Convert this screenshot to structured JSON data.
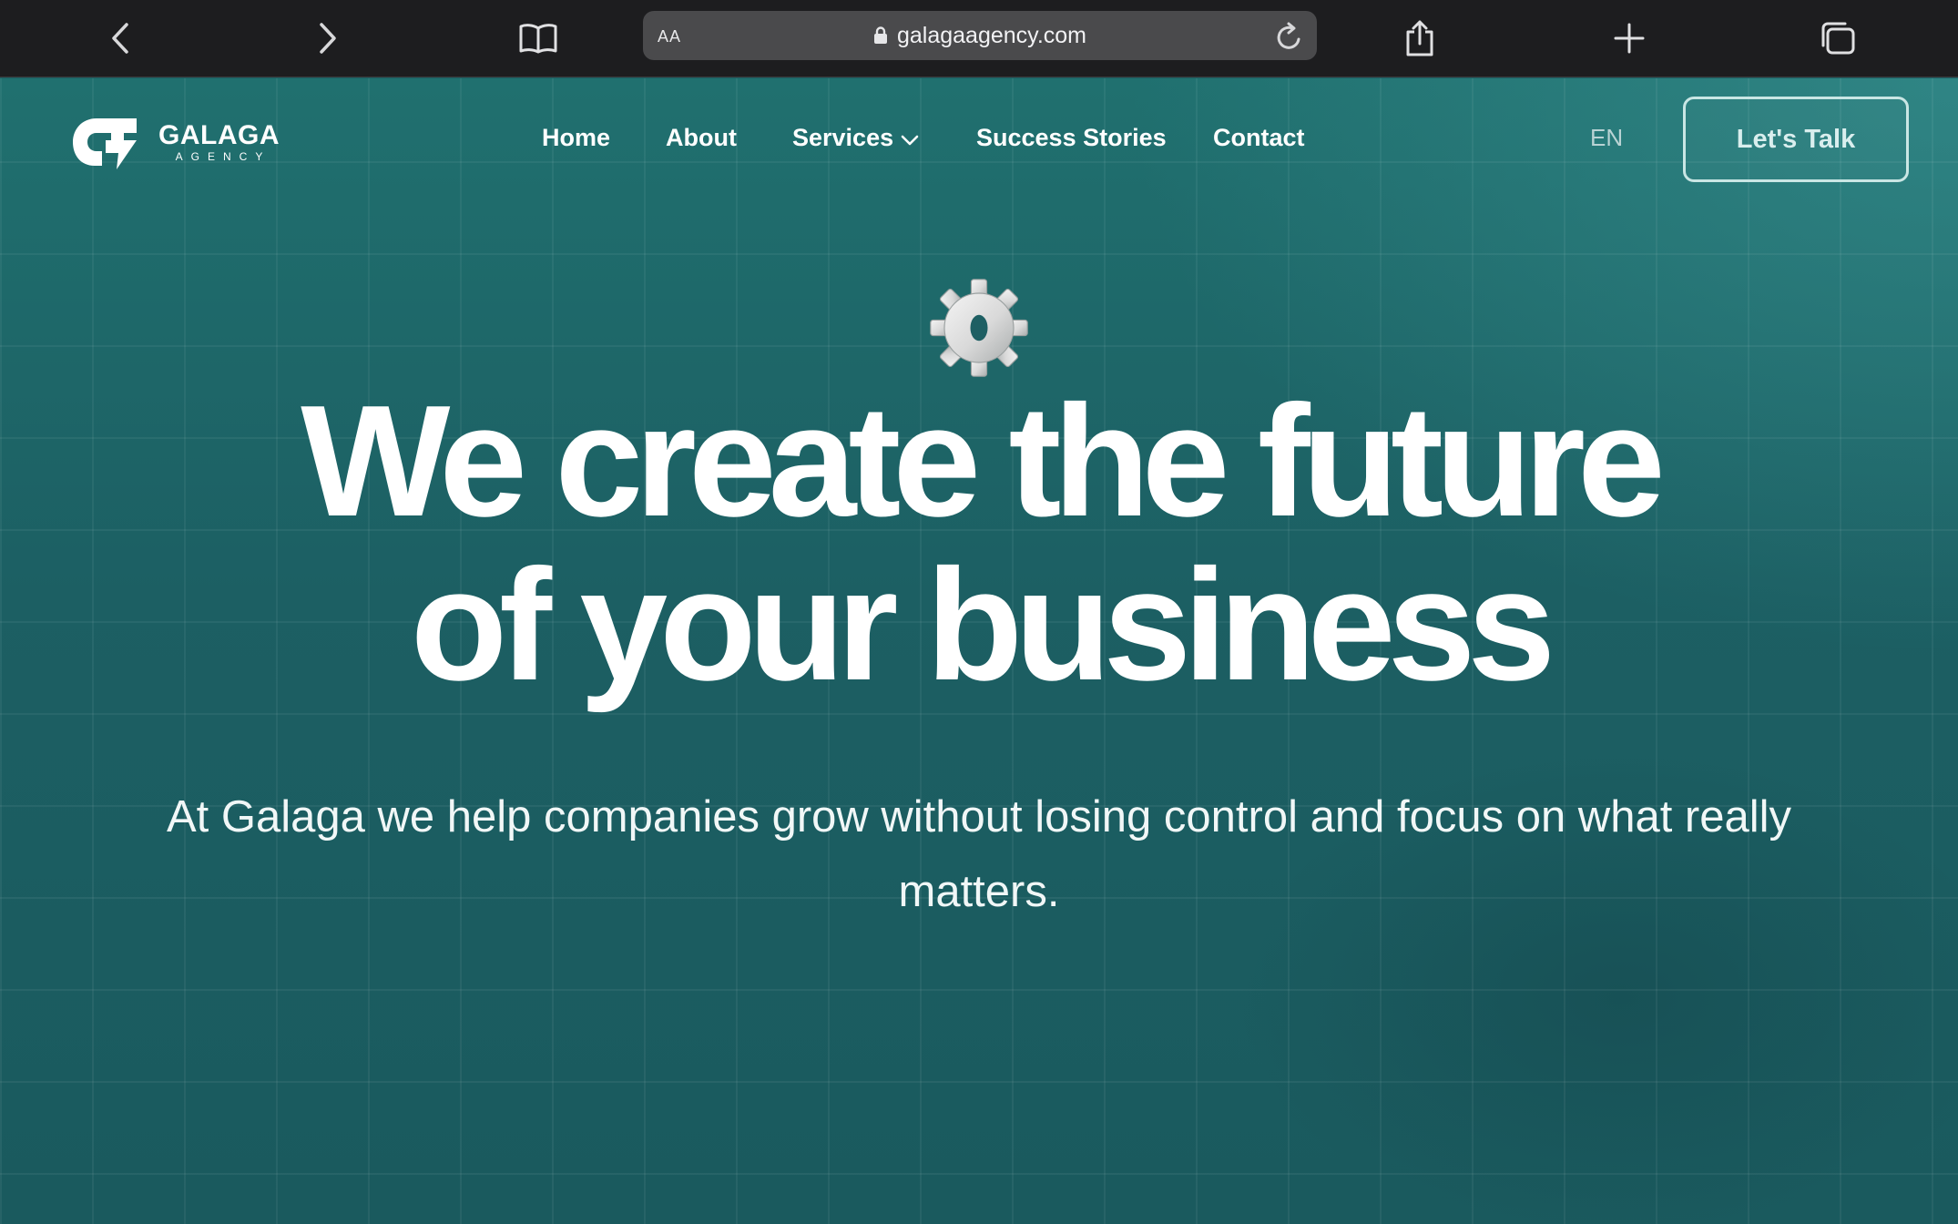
{
  "browser": {
    "reader_label": "AA",
    "url": "galagaagency.com",
    "icons": [
      "chevron-left-icon",
      "chevron-right-icon",
      "book-icon",
      "lock-icon",
      "reload-icon",
      "share-icon",
      "plus-icon",
      "tabs-icon"
    ]
  },
  "header": {
    "logo_name": "GALAGA",
    "logo_sub": "AGENCY",
    "nav": [
      {
        "label": "Home"
      },
      {
        "label": "About"
      },
      {
        "label": "Services",
        "has_dropdown": true
      },
      {
        "label": "Success Stories"
      },
      {
        "label": "Contact"
      }
    ],
    "language": "EN",
    "cta_label": "Let's Talk"
  },
  "hero": {
    "icon": "gear-icon",
    "headline_line1": "We create the future",
    "headline_line2": "of your business",
    "subtext": "At Galaga we help companies grow without losing control and focus on what really matters."
  },
  "colors": {
    "chrome_bg": "#1d1d1f",
    "page_bg": "#1c5a5e",
    "accent_border": "#c9e6e4",
    "text": "#ffffff"
  }
}
